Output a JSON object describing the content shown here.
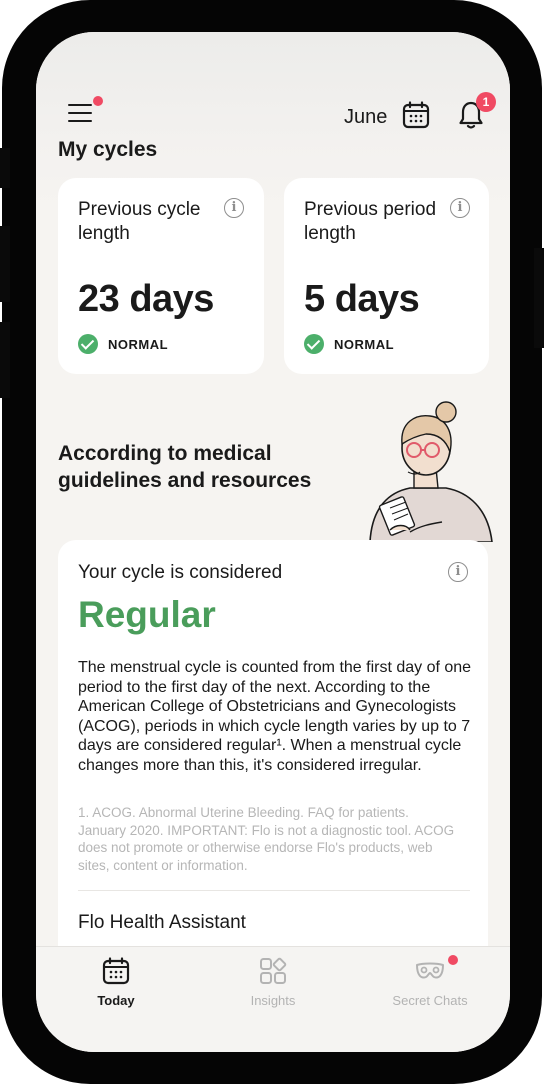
{
  "header": {
    "month": "June",
    "notification_count": "1"
  },
  "my_cycles": {
    "title": "My cycles",
    "cards": [
      {
        "label": "Previous cycle length",
        "value": "23 days",
        "status": "NORMAL"
      },
      {
        "label": "Previous period length",
        "value": "5 days",
        "status": "NORMAL"
      }
    ]
  },
  "guidelines": {
    "title": "According to medical guidelines and resources"
  },
  "regularity_card": {
    "heading": "Your cycle is considered",
    "verdict": "Regular",
    "body": "The menstrual cycle is counted from the first day of one period to the first day of the next. According to the American College of Obstetricians and Gynecologists (ACOG), periods in which cycle length varies by up to 7 days are considered regular¹. When a menstrual cycle changes more than this, it's considered irregular.",
    "footnote": "1. ACOG. Abnormal Uterine Bleeding. FAQ for patients. January 2020. IMPORTANT: Flo is not a diagnostic tool. ACOG does not promote or otherwise endorse Flo's products, web sites, content or information.",
    "assistant_title": "Flo Health Assistant"
  },
  "tabbar": {
    "tabs": [
      {
        "label": "Today",
        "icon": "calendar-icon",
        "active": true
      },
      {
        "label": "Insights",
        "icon": "insights-grid-icon",
        "active": false
      },
      {
        "label": "Secret Chats",
        "icon": "mask-icon",
        "active": false
      }
    ]
  },
  "colors": {
    "accent_green": "#4a9d5b",
    "check_green": "#4caf6a",
    "badge_red": "#f04a63",
    "background": "#f6f4f1"
  }
}
